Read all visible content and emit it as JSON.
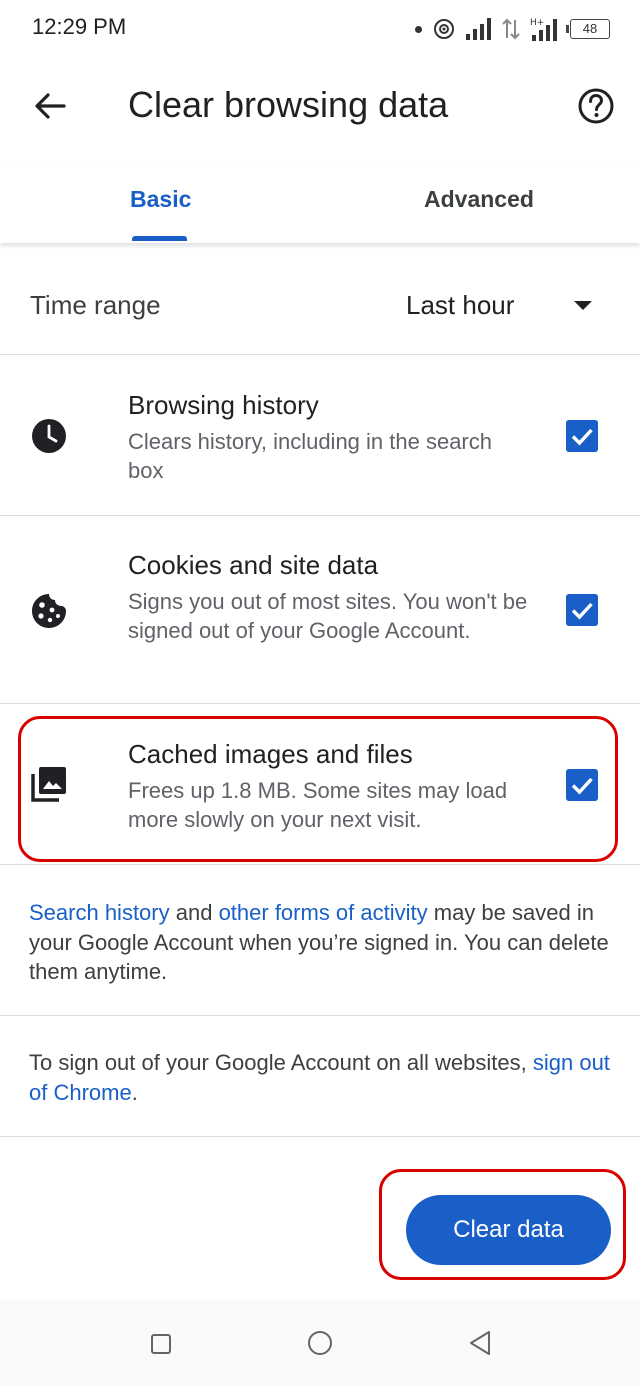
{
  "status_bar": {
    "time": "12:29 PM",
    "battery": "48",
    "icons": [
      "dot-icon",
      "hotspot-icon",
      "signal-icon",
      "data-arrows-icon",
      "hplus-signal-icon",
      "battery-icon"
    ]
  },
  "app_bar": {
    "title": "Clear browsing data",
    "back_icon": "arrow-back-icon",
    "help_icon": "help-circle-icon"
  },
  "tabs": [
    {
      "label": "Basic",
      "selected": true
    },
    {
      "label": "Advanced",
      "selected": false
    }
  ],
  "time_range": {
    "label": "Time range",
    "value": "Last hour"
  },
  "options": [
    {
      "icon": "clock-icon",
      "title": "Browsing history",
      "description": "Clears history, including in the search box",
      "checked": true
    },
    {
      "icon": "cookie-icon",
      "title": "Cookies and site data",
      "description": "Signs you out of most sites. You won't be signed out of your Google Account.",
      "checked": true
    },
    {
      "icon": "image-gallery-icon",
      "title": "Cached images and files",
      "description": "Frees up 1.8 MB. Some sites may load more slowly on your next visit.",
      "checked": true
    }
  ],
  "info": {
    "search_history_link": "Search history",
    "and": " and ",
    "other_activity_link": "other forms of activity",
    "rest": " may be saved in your Google Account when you’re signed in. You can delete them anytime."
  },
  "sign_out": {
    "text": "To sign out of your Google Account on all websites, ",
    "link": "sign out of Chrome",
    "period": "."
  },
  "clear_button": "Clear data",
  "colors": {
    "accent": "#1a5fc8",
    "highlight": "#d90000"
  }
}
